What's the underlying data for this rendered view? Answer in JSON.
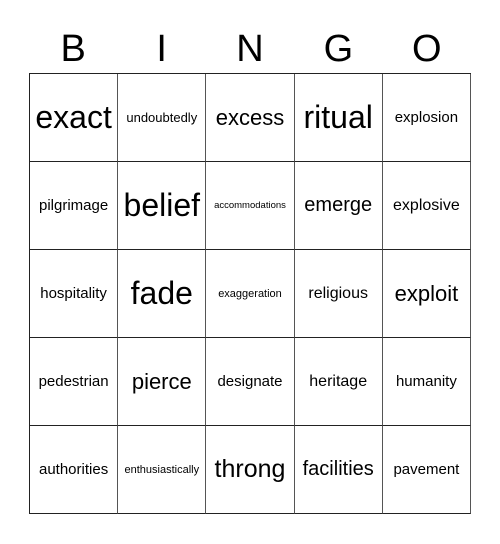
{
  "header": {
    "letters": [
      "B",
      "I",
      "N",
      "G",
      "O"
    ]
  },
  "cells": [
    [
      "exact",
      "undoubtedly",
      "excess",
      "ritual",
      "explosion"
    ],
    [
      "pilgrimage",
      "belief",
      "accommodations",
      "emerge",
      "explosive"
    ],
    [
      "hospitality",
      "fade",
      "exaggeration",
      "religious",
      "exploit"
    ],
    [
      "pedestrian",
      "pierce",
      "designate",
      "heritage",
      "humanity"
    ],
    [
      "authorities",
      "enthusiastically",
      "throng",
      "facilities",
      "pavement"
    ]
  ]
}
